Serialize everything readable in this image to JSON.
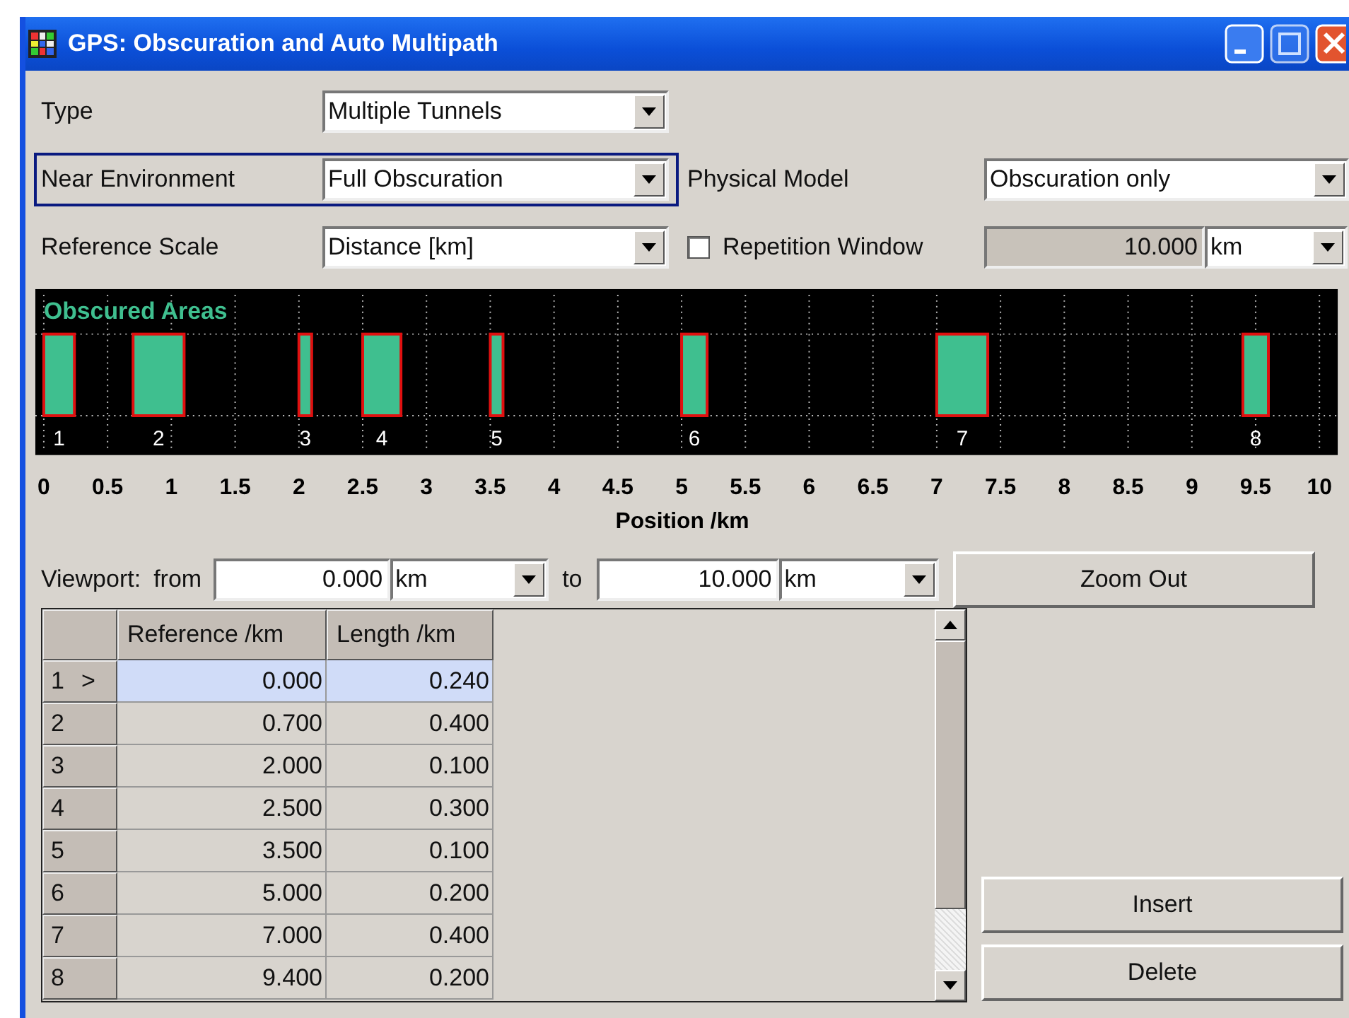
{
  "window": {
    "title": "GPS: Obscuration and Auto Multipath"
  },
  "settings": [
    {
      "label": "Type",
      "value": "Multiple Tunnels",
      "focused": false
    },
    {
      "label": "Near Environment",
      "value": "Full Obscuration",
      "focused": true
    },
    {
      "label": "Reference Scale",
      "value": "Distance [km]",
      "focused": false
    }
  ],
  "physical_model": {
    "label": "Physical Model",
    "value": "Obscuration only"
  },
  "repetition_window": {
    "label": "Repetition Window",
    "checked": false,
    "value": "10.000",
    "unit": "km",
    "disabled": true
  },
  "chart": {
    "title": "Obscured Areas",
    "xlabel": "Position /km",
    "ticks": [
      "0",
      "0.5",
      "1",
      "1.5",
      "2",
      "2.5",
      "3",
      "3.5",
      "4",
      "4.5",
      "5",
      "5.5",
      "6",
      "6.5",
      "7",
      "7.5",
      "8",
      "8.5",
      "9",
      "9.5",
      "10"
    ],
    "markers": [
      {
        "label": "1"
      },
      {
        "label": "2"
      },
      {
        "label": "3"
      },
      {
        "label": "4"
      },
      {
        "label": "5"
      },
      {
        "label": "6"
      },
      {
        "label": "7"
      },
      {
        "label": "8"
      }
    ]
  },
  "viewport": {
    "label": "Viewport:",
    "from_label": "from",
    "from": "0.000",
    "from_unit": "km",
    "to_label": "to",
    "to": "10.000",
    "to_unit": "km"
  },
  "buttons": {
    "zoom_out": "Zoom Out",
    "insert": "Insert",
    "delete": "Delete"
  },
  "table": {
    "columns": [
      "Reference /km",
      "Length /km"
    ],
    "rows": [
      {
        "label": "1",
        "marker": ">",
        "selected": true,
        "reference": "0.000",
        "length": "0.240"
      },
      {
        "label": "2",
        "selected": false,
        "reference": "0.700",
        "length": "0.400"
      },
      {
        "label": "3",
        "selected": false,
        "reference": "2.000",
        "length": "0.100"
      },
      {
        "label": "4",
        "selected": false,
        "reference": "2.500",
        "length": "0.300"
      },
      {
        "label": "5",
        "selected": false,
        "reference": "3.500",
        "length": "0.100"
      },
      {
        "label": "6",
        "selected": false,
        "reference": "5.000",
        "length": "0.200"
      },
      {
        "label": "7",
        "selected": false,
        "reference": "7.000",
        "length": "0.400"
      },
      {
        "label": "8",
        "selected": false,
        "reference": "9.400",
        "length": "0.200"
      }
    ]
  }
}
